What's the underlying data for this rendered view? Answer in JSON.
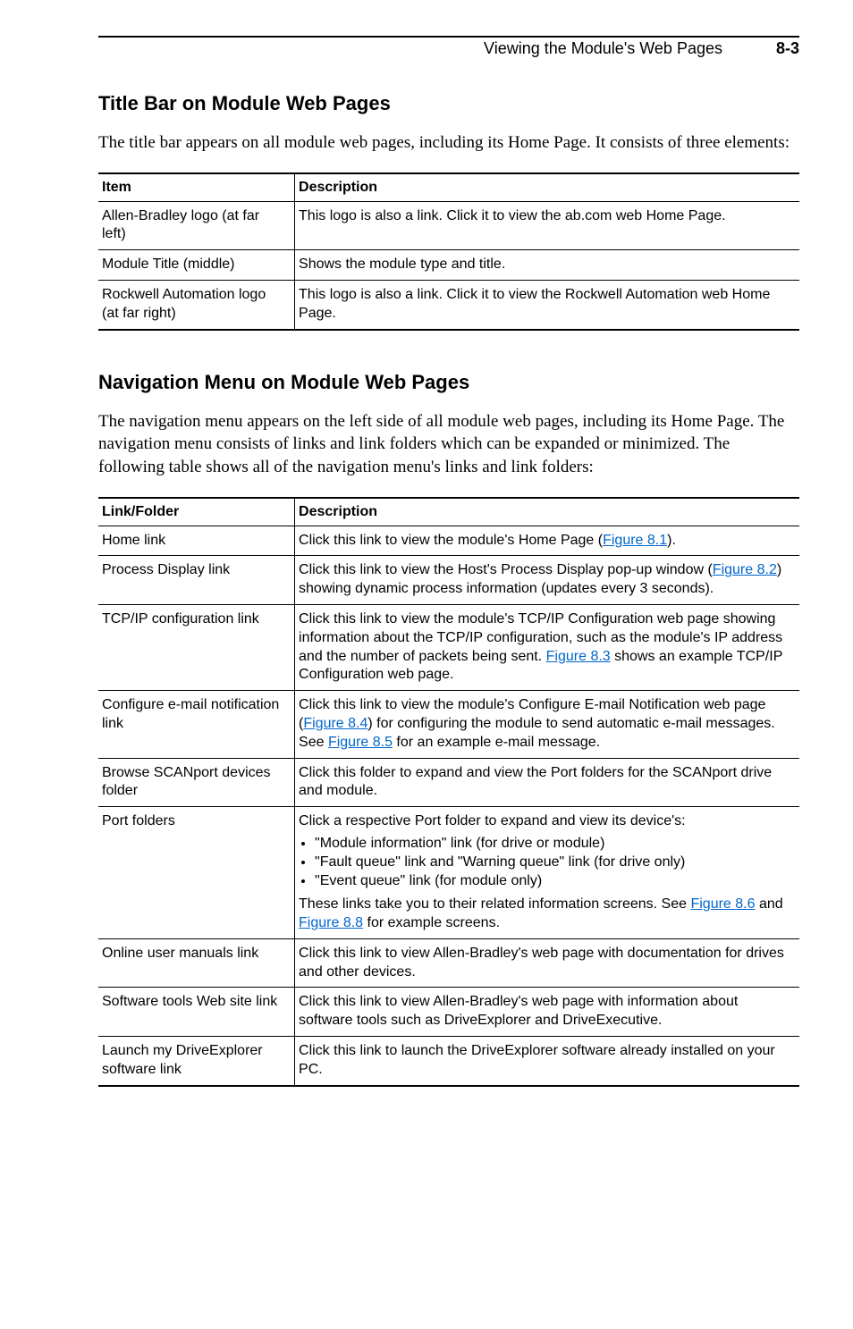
{
  "header": {
    "title": "Viewing the Module's Web Pages",
    "page_num": "8-3"
  },
  "section1": {
    "heading": "Title Bar on Module Web Pages",
    "para": "The title bar appears on all module web pages, including its Home Page. It consists of three elements:",
    "th_item": "Item",
    "th_desc": "Description",
    "rows": [
      {
        "item": "Allen-Bradley logo (at far left)",
        "desc": "This logo is also a link. Click it to view the ab.com web Home Page."
      },
      {
        "item": "Module Title (middle)",
        "desc": "Shows the module type and title."
      },
      {
        "item": "Rockwell Automation logo (at far right)",
        "desc": "This logo is also a link. Click it to view the Rockwell Automation web Home Page."
      }
    ]
  },
  "section2": {
    "heading": "Navigation Menu on Module Web Pages",
    "para": "The navigation menu appears on the left side of all module web pages, including its Home Page. The navigation menu consists of links and link folders which can be expanded or minimized. The following table shows all of the navigation menu's links and link folders:",
    "th_item": "Link/Folder",
    "th_desc": "Description",
    "rows": {
      "home": {
        "item": "Home link",
        "pre": "Click this link to view the module's Home Page (",
        "link": "Figure 8.1",
        "post": ")."
      },
      "process": {
        "item": "Process Display link",
        "line1": "Click this link to view the Host's Process Display pop-up window (",
        "link": "Figure 8.2",
        "line2": ") showing dynamic process information (updates every 3 seconds)."
      },
      "tcpip": {
        "item": "TCP/IP configuration link",
        "line1": "Click this link to view the module's TCP/IP Configuration web page showing information about the TCP/IP configuration, such as the module's IP address and the number of packets being sent. ",
        "link": "Figure 8.3",
        "line2": " shows an example TCP/IP Configuration web page."
      },
      "email": {
        "item": "Configure e-mail notification link",
        "line1": "Click this link to view the module's Configure E-mail Notification web page (",
        "link1": "Figure 8.4",
        "line2": ") for configuring the module to send automatic e-mail messages. See ",
        "link2": "Figure 8.5",
        "line3": " for an example e-mail message."
      },
      "browse": {
        "item": "Browse SCANport devices folder",
        "desc": "Click this folder to expand and view the Port folders for the SCANport drive and module."
      },
      "port": {
        "item": "Port folders",
        "intro": "Click a respective Port folder to expand and view its device's:",
        "b1": "\"Module information\" link (for drive or module)",
        "b2": "\"Fault queue\" link and \"Warning queue\" link (for drive only)",
        "b3": "\"Event queue\" link (for module only)",
        "line2a": "These links take you to their related information screens. See ",
        "link1": "Figure 8.6",
        "mid": " and ",
        "link2": "Figure 8.8",
        "line2b": " for example screens."
      },
      "manuals": {
        "item": "Online user manuals link",
        "desc": "Click this link to view Allen-Bradley's web page with documentation for drives and other devices."
      },
      "software": {
        "item": "Software tools Web site link",
        "desc": "Click this link to view Allen-Bradley's web page with information about software tools such as DriveExplorer and DriveExecutive."
      },
      "launch": {
        "item": "Launch my DriveExplorer software link",
        "desc": "Click this link to launch the DriveExplorer software already installed on your PC."
      }
    }
  }
}
